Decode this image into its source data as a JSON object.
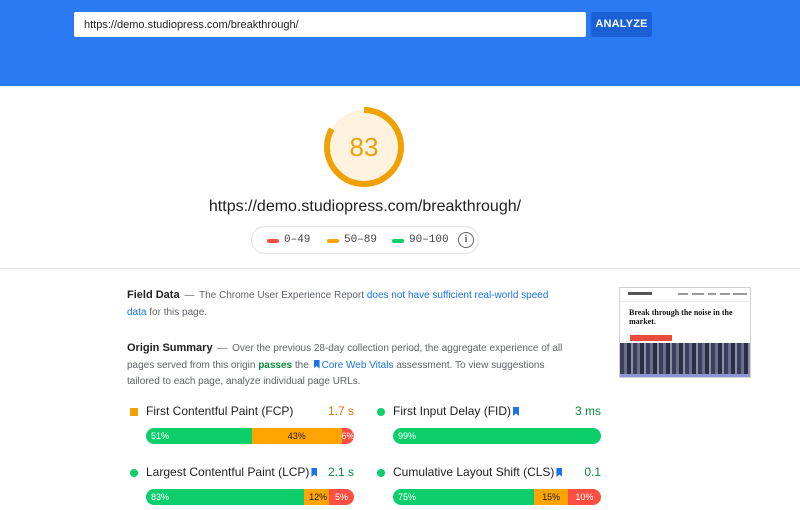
{
  "search": {
    "url_value": "https://demo.studiopress.com/breakthrough/",
    "analyze_label": "ANALYZE"
  },
  "score": {
    "value": "83",
    "fraction": 0.83
  },
  "page_url": "https://demo.studiopress.com/breakthrough/",
  "legend": {
    "poor": "0–49",
    "average": "50–89",
    "good": "90–100"
  },
  "field_data": {
    "heading": "Field Data",
    "text_before": "The Chrome User Experience Report",
    "link": "does not have sufficient real-world speed data",
    "text_after": "for this page."
  },
  "origin_summary": {
    "heading": "Origin Summary",
    "text_before": "Over the previous 28-day collection period, the aggregate experience of all pages served from this origin",
    "passes": "passes",
    "the": "the",
    "cwv_link": "Core Web Vitals",
    "text_after": "assessment. To view suggestions tailored to each page, analyze individual page URLs."
  },
  "thumbnail": {
    "headline": "Break through the noise in the market."
  },
  "metrics": [
    {
      "name": "First Contentful Paint (FCP)",
      "value": "1.7 s",
      "status": "average",
      "bar": {
        "good": "51%",
        "average": "43%",
        "poor": "6%"
      }
    },
    {
      "name": "First Input Delay (FID)",
      "value": "3 ms",
      "status": "good",
      "bar": {
        "good": "99%",
        "average": "",
        "poor": ""
      }
    },
    {
      "name": "Largest Contentful Paint (LCP)",
      "value": "2.1 s",
      "status": "good",
      "bar": {
        "good": "83%",
        "average": "12%",
        "poor": "5%"
      }
    },
    {
      "name": "Cumulative Layout Shift (CLS)",
      "value": "0.1",
      "status": "good",
      "bar": {
        "good": "75%",
        "average": "15%",
        "poor": "10%"
      }
    }
  ],
  "colors": {
    "blue_header": "#2a7af4",
    "good": "#0cce6b",
    "average": "#ffa400",
    "poor": "#ff4e42",
    "score_ring": "#f0a000"
  }
}
